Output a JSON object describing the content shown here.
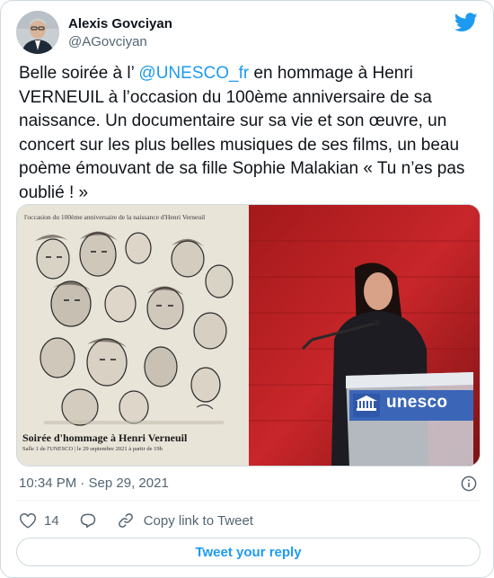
{
  "author": {
    "display_name": "Alexis Govciyan",
    "handle": "@AGovciyan"
  },
  "tweet": {
    "text_before_mention": "Belle soirée à l’ ",
    "mention": "@UNESCO_fr",
    "text_after_mention": " en hommage à Henri VERNEUIL à l’occasion du 100ème anniversaire de sa naissance. Un documentaire sur sa vie et son œuvre, un concert sur les plus belles musiques de ses films, un beau poème émouvant de sa fille Sophie Malakian « Tu n’es pas oublié ! »"
  },
  "media": {
    "poster": {
      "top_caption": "l'occasion du 100ème anniversaire de la naissance d'Henri Verneuil",
      "title": "Soirée d'hommage à Henri Verneuil",
      "subtitle": "Salle 1 de l'UNESCO | le 29 septembre 2021 à partir de 19h"
    },
    "podium_label": "unesco"
  },
  "meta": {
    "timestamp": "10:34 PM · Sep 29, 2021"
  },
  "actions": {
    "like_count": "14",
    "copy_link_label": "Copy link to Tweet"
  },
  "reply_button_label": "Tweet your reply",
  "colors": {
    "accent": "#1d9bf0",
    "secondary_text": "#536471",
    "border": "#cfd9de"
  }
}
